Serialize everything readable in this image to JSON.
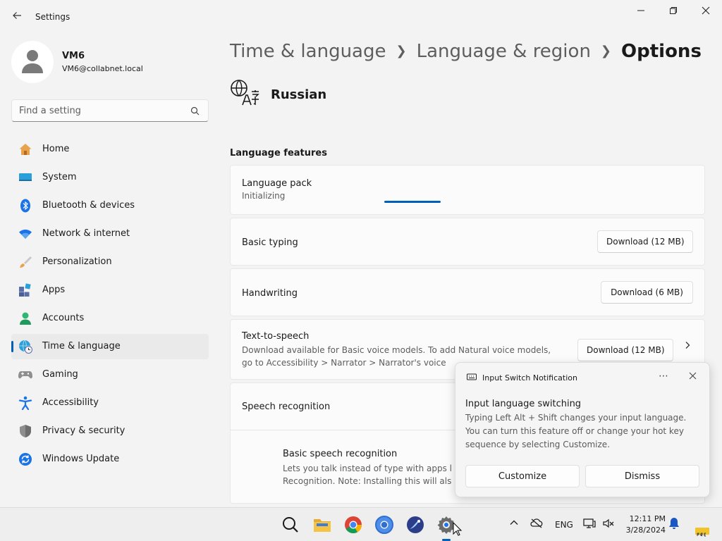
{
  "window": {
    "title": "Settings"
  },
  "profile": {
    "name": "VM6",
    "email": "VM6@collabnet.local"
  },
  "search": {
    "placeholder": "Find a setting"
  },
  "nav": {
    "items": [
      {
        "label": "Home"
      },
      {
        "label": "System"
      },
      {
        "label": "Bluetooth & devices"
      },
      {
        "label": "Network & internet"
      },
      {
        "label": "Personalization"
      },
      {
        "label": "Apps"
      },
      {
        "label": "Accounts"
      },
      {
        "label": "Time & language"
      },
      {
        "label": "Gaming"
      },
      {
        "label": "Accessibility"
      },
      {
        "label": "Privacy & security"
      },
      {
        "label": "Windows Update"
      }
    ],
    "active": "Time & language"
  },
  "breadcrumb": {
    "level1": "Time & language",
    "level2": "Language & region",
    "current": "Options"
  },
  "language": {
    "name": "Russian"
  },
  "features": {
    "heading": "Language features",
    "language_pack": {
      "title": "Language pack",
      "status": "Initializing"
    },
    "basic_typing": {
      "title": "Basic typing",
      "button": "Download (12 MB)"
    },
    "handwriting": {
      "title": "Handwriting",
      "button": "Download (6 MB)"
    },
    "tts": {
      "title": "Text-to-speech",
      "desc_line1": "Download available for Basic voice models. To add Natural voice models,",
      "desc_line2": "go to Accessibility > Narrator > Narrator's voice",
      "button": "Download (12 MB)"
    },
    "speech": {
      "title": "Speech recognition"
    },
    "basic_speech": {
      "title": "Basic speech recognition",
      "desc_line1": "Lets you talk instead of type with apps l",
      "desc_line2": "Recognition. Note: Installing this will als"
    }
  },
  "toast": {
    "app": "Input Switch Notification",
    "title": "Input language switching",
    "body": "Typing Left Alt + Shift changes your input language. You can turn this feature off or change your hot key sequence by selecting Customize.",
    "customize": "Customize",
    "dismiss": "Dismiss"
  },
  "taskbar": {
    "lang": "ENG",
    "time": "12:11 PM",
    "date": "3/28/2024"
  },
  "colors": {
    "accent": "#005fb8",
    "background": "#f3f3f3",
    "card": "#fbfbfb"
  }
}
